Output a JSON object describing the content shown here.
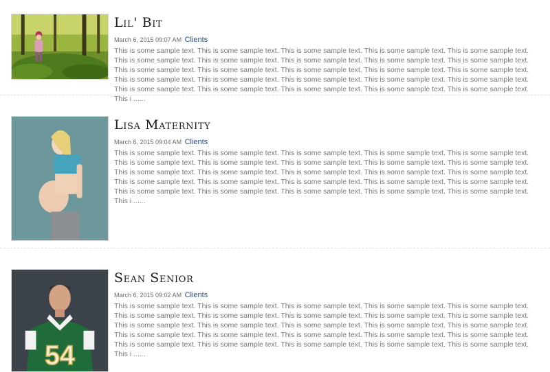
{
  "posts": [
    {
      "title": "Lil' Bit",
      "date": "March 6, 2015 09:07 AM",
      "category": "Clients",
      "excerpt": "This is some sample text. This is some sample text. This is some sample text. This is some sample text. This is some sample text. This is some sample text. This is some sample text. This is some sample text. This is some sample text. This is some sample text. This is some sample text. This is some sample text. This is some sample text. This is some sample text. This is some sample text. This is some sample text. This is some sample text. This is some sample text. This is some sample text. This is some sample text. This is some sample text. This is some sample text. This is some sample text. This is some sample text. This is some sample text. This i ......"
    },
    {
      "title": "Lisa Maternity",
      "date": "March 6, 2015 09:04 AM",
      "category": "Clients",
      "excerpt": "This is some sample text. This is some sample text. This is some sample text. This is some sample text. This is some sample text. This is some sample text. This is some sample text. This is some sample text. This is some sample text. This is some sample text. This is some sample text. This is some sample text. This is some sample text. This is some sample text. This is some sample text. This is some sample text. This is some sample text. This is some sample text. This is some sample text. This is some sample text. This is some sample text. This is some sample text. This is some sample text. This is some sample text. This is some sample text. This i ......"
    },
    {
      "title": "Sean Senior",
      "date": "March 6, 2015 09:02 AM",
      "category": "Clients",
      "excerpt": "This is some sample text. This is some sample text. This is some sample text. This is some sample text. This is some sample text. This is some sample text. This is some sample text. This is some sample text. This is some sample text. This is some sample text. This is some sample text. This is some sample text. This is some sample text. This is some sample text. This is some sample text. This is some sample text. This is some sample text. This is some sample text. This is some sample text. This is some sample text. This is some sample text. This is some sample text. This is some sample text. This is some sample text. This is some sample text. This i ......",
      "jersey_number": "54"
    }
  ],
  "colors": {
    "title": "#1a1a1a",
    "meta": "#666666",
    "category_link": "#2a4e86",
    "excerpt": "#777777",
    "divider": "#e3e3e3"
  }
}
